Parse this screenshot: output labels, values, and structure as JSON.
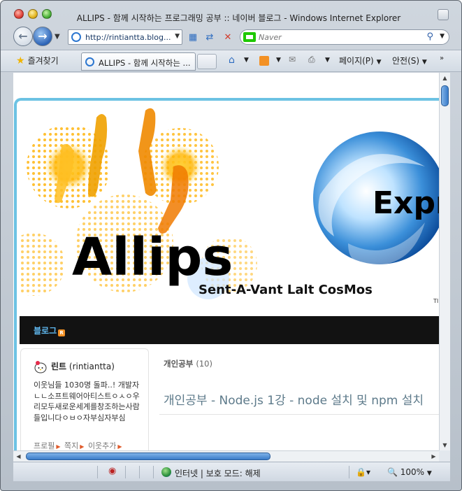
{
  "window": {
    "title": "ALLIPS - 함께 시작하는 프로그래밍 공부 :: 네이버 블로그 - Windows Internet Explorer"
  },
  "address_bar": {
    "url": "http://rintiantta.blog..."
  },
  "search": {
    "placeholder": "Naver"
  },
  "tabs": {
    "favorites_label": "즐겨찾기",
    "active_tab_label": "ALLIPS - 함께 시작하는 ..."
  },
  "command_bar": {
    "page_label": "페이지(P)",
    "safety_label": "안전(S)"
  },
  "banner": {
    "brand": "Allips",
    "tagline": "Sent-A-Vant Lalt CosMos",
    "partial_word": "Expr",
    "small_mark": "TI"
  },
  "blog_nav": {
    "blog_link": "블로그",
    "rss_mark": "R"
  },
  "profile": {
    "nickname": "린트",
    "user_id": "(rintiantta)",
    "intro": "이웃님들 1030명 돌파..! 개발자ㄴㄴ소프트웨어아티스트ㅇㅅㅇ우리모두새로운세계를창조하는사람들입니다ㅇㅂㅇ자부심자부심",
    "link_profile": "프로필",
    "link_message": "쪽지",
    "link_add_neighbor": "이웃추가"
  },
  "post_list": {
    "category_name": "개인공부",
    "category_count": "(10)",
    "post_title": "개인공부 - Node.js 1강 - node 설치 및 npm 설치"
  },
  "status_bar": {
    "zone_text": "인터넷 | 보호 모드: 해제",
    "zoom": "100%"
  }
}
